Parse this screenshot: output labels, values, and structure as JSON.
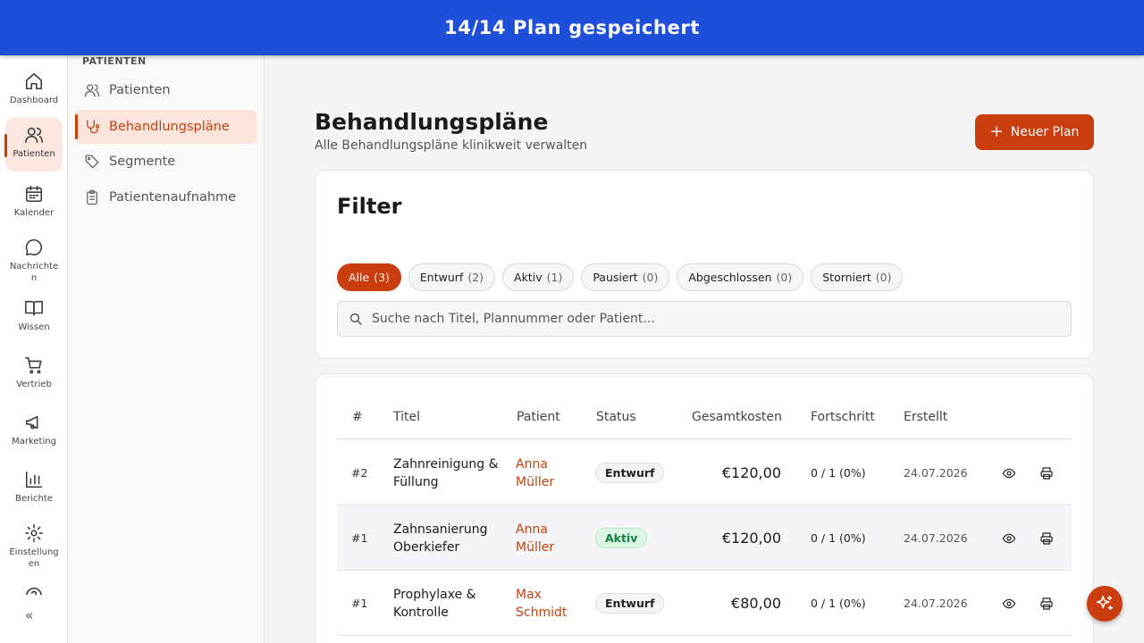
{
  "banner": {
    "text": "14/14 Plan gespeichert"
  },
  "rail": {
    "items": [
      {
        "label": "Dashboard",
        "icon": "home-icon"
      },
      {
        "label": "Patienten",
        "icon": "users-icon",
        "active": true
      },
      {
        "label": "Kalender",
        "icon": "calendar-icon"
      },
      {
        "label": "Nachrichten",
        "icon": "message-icon"
      },
      {
        "label": "Wissen",
        "icon": "book-icon"
      },
      {
        "label": "Vertrieb",
        "icon": "cart-icon"
      },
      {
        "label": "Marketing",
        "icon": "megaphone-icon"
      },
      {
        "label": "Berichte",
        "icon": "chart-icon"
      },
      {
        "label": "Einstellungen",
        "icon": "gear-icon"
      }
    ],
    "collapse_label": "«"
  },
  "subnav": {
    "heading": "PATIENTEN",
    "items": [
      {
        "label": "Patienten",
        "icon": "users-icon"
      },
      {
        "label": "Behandlungspläne",
        "icon": "stethoscope-icon",
        "active": true
      },
      {
        "label": "Segmente",
        "icon": "tag-icon"
      },
      {
        "label": "Patientenaufnahme",
        "icon": "clipboard-icon"
      }
    ]
  },
  "header": {
    "title": "Behandlungspläne",
    "subtitle": "Alle Behandlungspläne klinikweit verwalten",
    "new_button": "Neuer Plan",
    "new_button_icon": "+"
  },
  "filter": {
    "title": "Filter",
    "chips": [
      {
        "label": "Alle",
        "count": "(3)",
        "active": true
      },
      {
        "label": "Entwurf",
        "count": "(2)"
      },
      {
        "label": "Aktiv",
        "count": "(1)"
      },
      {
        "label": "Pausiert",
        "count": "(0)"
      },
      {
        "label": "Abgeschlossen",
        "count": "(0)"
      },
      {
        "label": "Storniert",
        "count": "(0)"
      }
    ],
    "search_placeholder": "Suche nach Titel, Plannummer oder Patient..."
  },
  "table": {
    "columns": [
      "#",
      "Titel",
      "Patient",
      "Status",
      "Gesamtkosten",
      "Fortschritt",
      "Erstellt"
    ],
    "rows": [
      {
        "num": "#2",
        "title": "Zahnreinigung & Füllung",
        "patient": "Anna Müller",
        "status": "Entwurf",
        "cost": "€120,00",
        "progress": "0 / 1 (0%)",
        "created": "24.07.2026"
      },
      {
        "num": "#1",
        "title": "Zahnsanierung Oberkiefer",
        "patient": "Anna Müller",
        "status": "Aktiv",
        "cost": "€120,00",
        "progress": "0 / 1 (0%)",
        "created": "24.07.2026"
      },
      {
        "num": "#1",
        "title": "Prophylaxe & Kontrolle",
        "patient": "Max Schmidt",
        "status": "Entwurf",
        "cost": "€80,00",
        "progress": "0 / 1 (0%)",
        "created": "24.07.2026"
      }
    ]
  },
  "colors": {
    "accent": "#c93d0e",
    "banner": "#1d4fd8",
    "status_active": "#15803d"
  }
}
